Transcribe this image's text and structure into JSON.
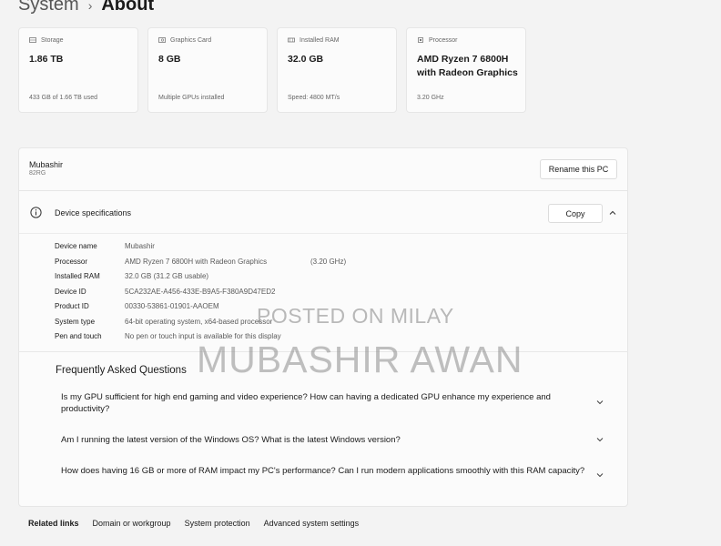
{
  "breadcrumb": {
    "parent": "System",
    "separator": "›",
    "current": "About"
  },
  "cards": [
    {
      "icon": "storage-icon",
      "label": "Storage",
      "value": "1.86 TB",
      "sub": "433 GB of 1.66 TB used"
    },
    {
      "icon": "graphics-card-icon",
      "label": "Graphics Card",
      "value": "8 GB",
      "sub": "Multiple GPUs installed"
    },
    {
      "icon": "ram-icon",
      "label": "Installed RAM",
      "value": "32.0 GB",
      "sub": "Speed: 4800 MT/s"
    },
    {
      "icon": "processor-icon",
      "label": "Processor",
      "value": "AMD Ryzen 7 6800H with Radeon Graphics",
      "sub": "3.20 GHz"
    }
  ],
  "pc": {
    "name": "Mubashir",
    "model": "82RG",
    "rename_label": "Rename this PC"
  },
  "device_specs": {
    "title": "Device specifications",
    "copy_label": "Copy",
    "rows": [
      {
        "key": "Device name",
        "value": "Mubashir",
        "extra": ""
      },
      {
        "key": "Processor",
        "value": "AMD Ryzen 7 6800H with Radeon Graphics",
        "extra": "(3.20 GHz)"
      },
      {
        "key": "Installed RAM",
        "value": "32.0 GB (31.2 GB usable)",
        "extra": ""
      },
      {
        "key": "Device ID",
        "value": "5CA232AE-A456-433E-B9A5-F380A9D47ED2",
        "extra": ""
      },
      {
        "key": "Product ID",
        "value": "00330-53861-01901-AAOEM",
        "extra": ""
      },
      {
        "key": "System type",
        "value": "64-bit operating system, x64-based processor",
        "extra": ""
      },
      {
        "key": "Pen and touch",
        "value": "No pen or touch input is available for this display",
        "extra": ""
      }
    ]
  },
  "faq": {
    "title": "Frequently Asked Questions",
    "items": [
      "Is my GPU sufficient for high end gaming and video experience? How can having a dedicated GPU enhance my experience and productivity?",
      "Am I running the latest version of the Windows OS? What is the latest Windows version?",
      "How does having 16 GB or more of RAM impact my PC's performance? Can I run modern applications smoothly with this RAM capacity?"
    ]
  },
  "related": {
    "label": "Related links",
    "links": [
      "Domain or workgroup",
      "System protection",
      "Advanced system settings"
    ]
  },
  "watermark": {
    "line1": "POSTED ON MILAY",
    "line2": "MUBASHIR AWAN"
  }
}
